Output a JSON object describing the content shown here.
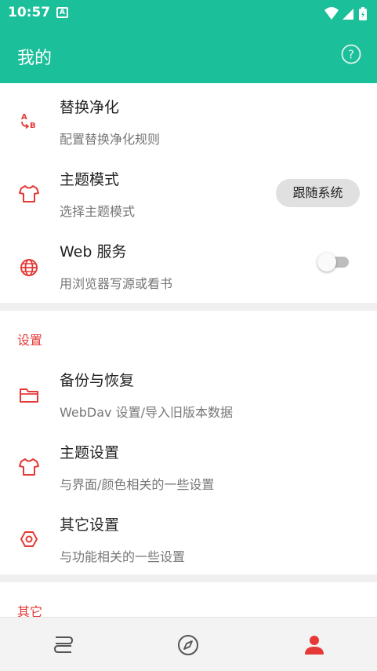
{
  "status_bar": {
    "time": "10:57",
    "notification_badge": "A",
    "icons": [
      "wifi-icon",
      "cellular-signal-icon",
      "battery-charging-icon"
    ]
  },
  "app_bar": {
    "title": "我的",
    "help_icon": "help-circle-icon"
  },
  "colors": {
    "accent": "#1bbf9a",
    "icon_red": "#e53935",
    "section_red": "#e53935"
  },
  "items": {
    "replace": {
      "title": "替换净化",
      "subtitle": "配置替换净化规则",
      "icon": "replace-ab-icon"
    },
    "theme_mode": {
      "title": "主题模式",
      "subtitle": "选择主题模式",
      "value": "跟随系统",
      "icon": "tshirt-icon"
    },
    "web_service": {
      "title": "Web 服务",
      "subtitle": "用浏览器写源或看书",
      "toggle_on": false,
      "icon": "globe-icon"
    }
  },
  "settings_section": {
    "header": "设置",
    "backup": {
      "title": "备份与恢复",
      "subtitle": "WebDav 设置/导入旧版本数据",
      "icon": "folder-icon"
    },
    "theme_settings": {
      "title": "主题设置",
      "subtitle": "与界面/颜色相关的一些设置",
      "icon": "tshirt-icon"
    },
    "other_settings": {
      "title": "其它设置",
      "subtitle": "与功能相关的一些设置",
      "icon": "hexagon-settings-icon"
    }
  },
  "other_section": {
    "header": "其它"
  },
  "bottom_nav": {
    "items": [
      "bookshelf-icon",
      "explore-compass-icon",
      "profile-person-icon"
    ],
    "active": "profile-person-icon"
  }
}
